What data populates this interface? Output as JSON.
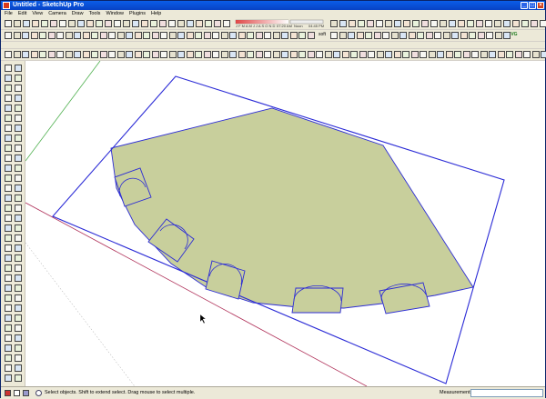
{
  "window": {
    "title": "Untitled - SketchUp Pro"
  },
  "menu": [
    "File",
    "Edit",
    "View",
    "Camera",
    "Draw",
    "Tools",
    "Window",
    "Plugins",
    "Help"
  ],
  "toolbar": {
    "shadow_time": "07:20 AM",
    "shadow_noon": "Noon",
    "shadow_pm": "04:45 PM",
    "months": "J F M A M J J A S O N D",
    "soften_label": "soft",
    "svg_label": "SVG"
  },
  "status": {
    "message": "Select objects. Shift to extend select. Drag mouse to select multiple.",
    "measurements_label": "Measurements",
    "measurements_value": ""
  },
  "colors": {
    "face": "#c8cf9c",
    "edge": "#2b2bd6",
    "red_axis": "#b0325a",
    "green_axis": "#4fb04f"
  },
  "model": {
    "shape": "fan-shaped floor face with five arched openings, enclosed by a rotated rectangle"
  }
}
